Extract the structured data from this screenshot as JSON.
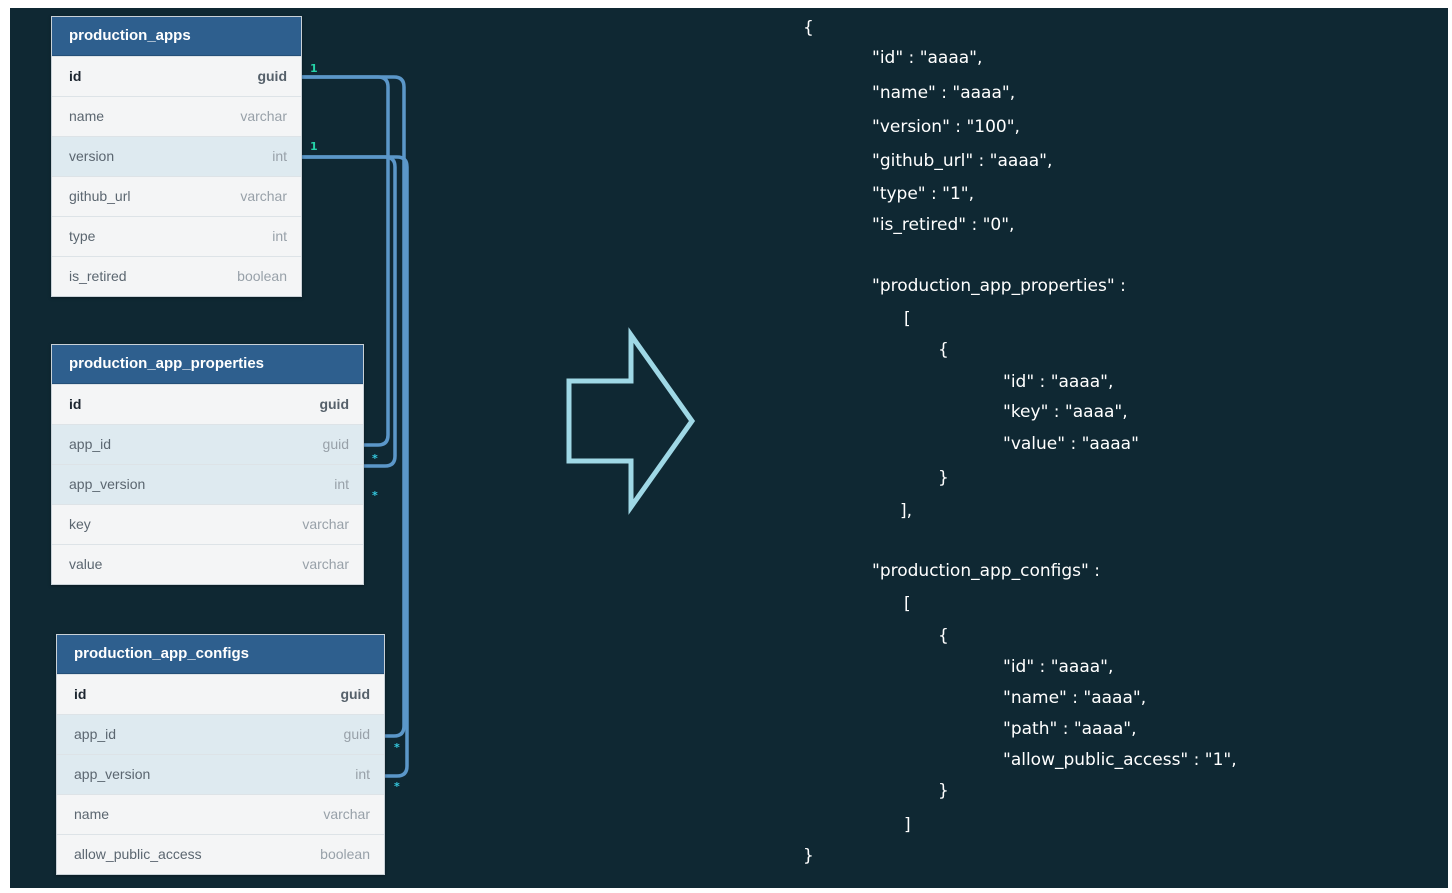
{
  "tables": [
    {
      "name": "production_apps",
      "fields": [
        {
          "name": "id",
          "type": "guid",
          "pk": true
        },
        {
          "name": "name",
          "type": "varchar"
        },
        {
          "name": "version",
          "type": "int",
          "highlight": true
        },
        {
          "name": "github_url",
          "type": "varchar"
        },
        {
          "name": "type",
          "type": "int"
        },
        {
          "name": "is_retired",
          "type": "boolean"
        }
      ]
    },
    {
      "name": "production_app_properties",
      "fields": [
        {
          "name": "id",
          "type": "guid",
          "pk": true
        },
        {
          "name": "app_id",
          "type": "guid",
          "highlight": true
        },
        {
          "name": "app_version",
          "type": "int",
          "highlight": true
        },
        {
          "name": "key",
          "type": "varchar"
        },
        {
          "name": "value",
          "type": "varchar"
        }
      ]
    },
    {
      "name": "production_app_configs",
      "fields": [
        {
          "name": "id",
          "type": "guid",
          "pk": true
        },
        {
          "name": "app_id",
          "type": "guid",
          "highlight": true
        },
        {
          "name": "app_version",
          "type": "int",
          "highlight": true
        },
        {
          "name": "name",
          "type": "varchar"
        },
        {
          "name": "allow_public_access",
          "type": "boolean"
        }
      ]
    }
  ],
  "relations": {
    "one_label": "1",
    "many_label": "*"
  },
  "arrow_color": "#9fd8e6",
  "link_color": "#5b97c9",
  "json_lines": [
    "{",
    "\"id\" : \"aaaa\",",
    "\"name\" : \"aaaa\",",
    "\"version\" : \"100\",",
    "\"github_url\" : \"aaaa\",",
    "\"type\" : \"1\",",
    "\"is_retired\" : \"0\",",
    "\"production_app_properties\" :",
    "[",
    "{",
    "\"id\" : \"aaaa\",",
    "\"key\" : \"aaaa\",",
    "\"value\" : \"aaaa\"",
    "}",
    "],",
    "\"production_app_configs\" :",
    "[",
    "{",
    "\"id\" : \"aaaa\",",
    "\"name\" : \"aaaa\",",
    "\"path\" : \"aaaa\",",
    "\"allow_public_access\" : \"1\",",
    "}",
    "]",
    "}"
  ]
}
